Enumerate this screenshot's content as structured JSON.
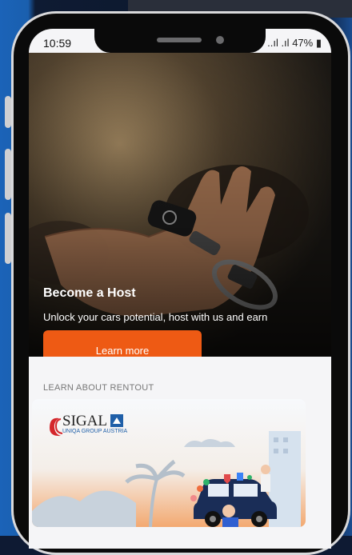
{
  "status": {
    "time": "10:59",
    "signal": "..ıl .ıl",
    "battery": "47%"
  },
  "hero": {
    "title": "Become a Host",
    "subtitle": "Unlock your cars potential, host with us and earn",
    "button": "Learn more"
  },
  "section": {
    "label": "LEARN ABOUT RENTOUT"
  },
  "card": {
    "brand": "SIGAL",
    "tagline": "UNIQA GROUP AUSTRIA"
  },
  "colors": {
    "accent": "#ee5a14",
    "brand_red": "#d4262b",
    "brand_blue": "#1f5fa8"
  }
}
